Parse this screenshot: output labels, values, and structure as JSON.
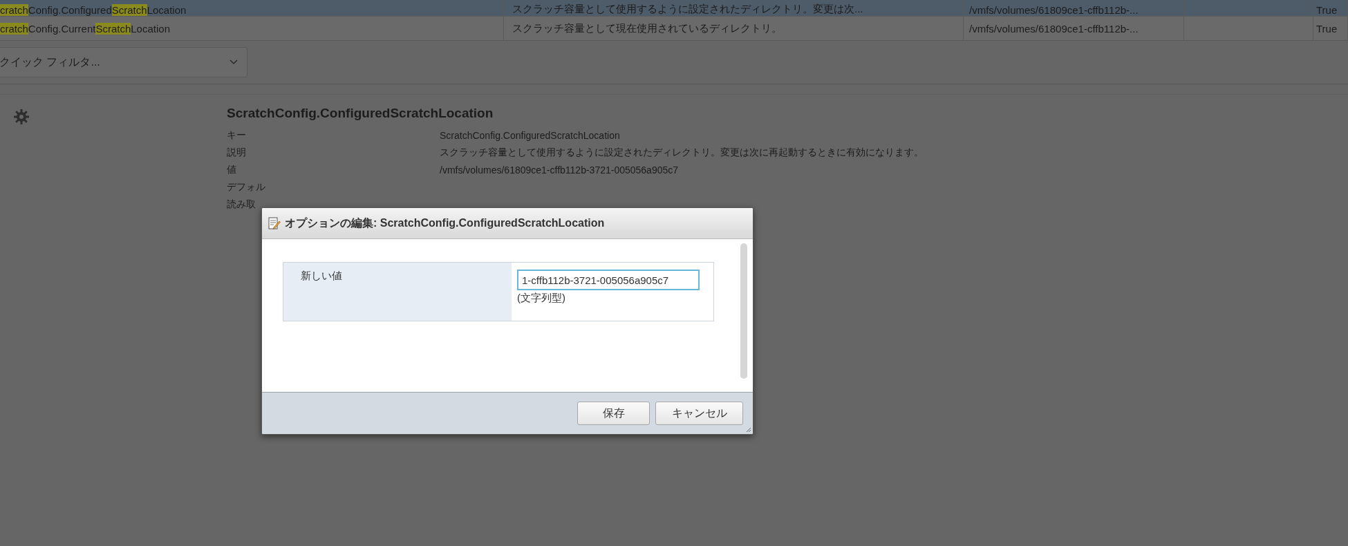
{
  "table": {
    "rows": [
      {
        "selected": true,
        "name": [
          {
            "text": "cratch",
            "highlight": true
          },
          {
            "text": "Config.Configured",
            "highlight": false
          },
          {
            "text": "Scratch",
            "highlight": true
          },
          {
            "text": "Location",
            "highlight": false
          }
        ],
        "description": "スクラッチ容量として使用するように設定されたディレクトリ。変更は次...",
        "value": "/vmfs/volumes/61809ce1-cffb112b-...",
        "column_5": "True"
      },
      {
        "selected": false,
        "name": [
          {
            "text": "cratch",
            "highlight": true
          },
          {
            "text": "Config.Current",
            "highlight": false
          },
          {
            "text": "Scratch",
            "highlight": true
          },
          {
            "text": "Location",
            "highlight": false
          }
        ],
        "description": "スクラッチ容量として現在使用されているディレクトリ。",
        "value": "/vmfs/volumes/61809ce1-cffb112b-...",
        "column_5": "True"
      }
    ]
  },
  "filter": {
    "placeholder": "クイック フィルタ..."
  },
  "details": {
    "title": "ScratchConfig.ConfiguredScratchLocation",
    "rows": [
      {
        "label": "キー",
        "value": "ScratchConfig.ConfiguredScratchLocation"
      },
      {
        "label": "説明",
        "value": "スクラッチ容量として使用するように設定されたディレクトリ。変更は次に再起動するときに有効になります。"
      },
      {
        "label": "値",
        "value": "/vmfs/volumes/61809ce1-cffb112b-3721-005056a905c7"
      },
      {
        "label": "デフォル"
      },
      {
        "label": "読み取"
      }
    ]
  },
  "dialog": {
    "title": "オプションの編集: ScratchConfig.ConfiguredScratchLocation",
    "field_label": "新しい値",
    "value": "1-cffb112b-3721-005056a905c7",
    "type_hint": "(文字列型)",
    "buttons": [
      "保存",
      "キャンセル"
    ]
  }
}
